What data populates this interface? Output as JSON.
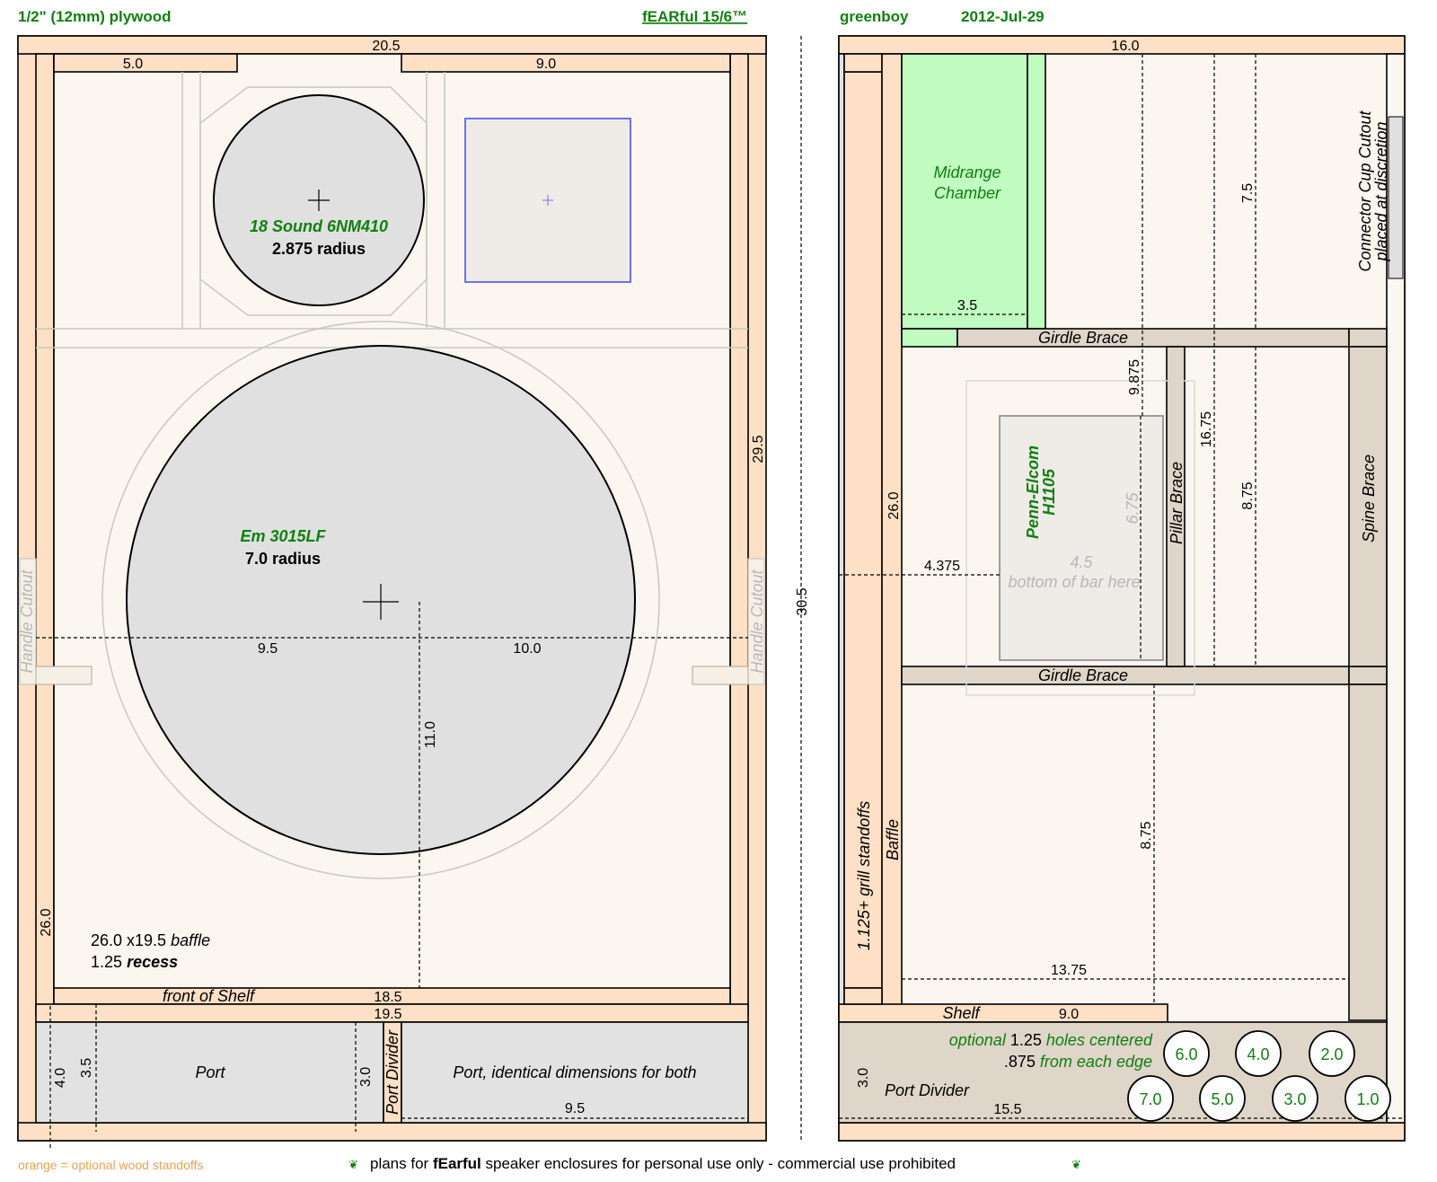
{
  "header": {
    "material": "1/2\" (12mm) plywood",
    "title": "fEARful 15/6™",
    "author": "greenboy",
    "date": "2012-Jul-29"
  },
  "front": {
    "dim_top": "20.5",
    "dim_5": "5.0",
    "dim_9": "9.0",
    "dim_29_5": "29.5",
    "dim_26": "26.0",
    "dim_9_5": "9.5",
    "dim_10": "10.0",
    "dim_11": "11.0",
    "dim_18_5": "18.5",
    "dim_19_5": "19.5",
    "dim_4": "4.0",
    "dim_3_5": "3.5",
    "dim_3": "3.0",
    "dim_port_w": "9.5",
    "mid_driver": "18 Sound 6NM410",
    "mid_radius": "2.875 radius",
    "woofer": "Em 3015LF",
    "woofer_radius": "7.0 radius",
    "handle_left": "Handle Cutout",
    "handle_right": "Handle Cutout",
    "baffle_note": "26.0 x19.5",
    "baffle_word": "baffle",
    "recess_val": "1.25",
    "recess_word": "recess",
    "shelf_front": "front of Shelf",
    "port_left": "Port",
    "port_divider": "Port Divider",
    "port_right": "Port, identical dimensions for both"
  },
  "overall_height": "30.5",
  "side": {
    "dim_top": "16.0",
    "connector": "Connector Cup Cutout",
    "connector_note": "placed at discretion",
    "dim_7_5": "7.5",
    "midrange_chamber_1": "Midrange",
    "midrange_chamber_2": "Chamber",
    "dim_3_5": "3.5",
    "girdle_top": "Girdle Brace",
    "dim_9_875": "9.875",
    "dim_16_75": "16.75",
    "dim_8_75_top": "8.75",
    "spine": "Spine Brace",
    "pillar": "Pillar Brace",
    "dim_26": "26.0",
    "horn_1": "Penn-Elcom",
    "horn_2": "H1105",
    "dim_6_75": "6.75",
    "dim_4_5": "4.5",
    "bar_note": "bottom of bar here",
    "dim_4_375": "4.375",
    "girdle_bottom": "Girdle Brace",
    "dim_8_75_bottom": "8.75",
    "baffle": "Baffle",
    "grill": "1.125+ grill standoffs",
    "dim_13_75": "13.75",
    "shelf": "Shelf",
    "dim_9": "9.0",
    "holes_note_1a": "optional",
    "holes_note_1b": "1.25",
    "holes_note_1c": "holes centered",
    "holes_note_2a": ".875",
    "holes_note_2b": "from each edge",
    "dim_3": "3.0",
    "port_divider": "Port Divider",
    "dim_15_5": "15.5",
    "holes_top": [
      "6.0",
      "4.0",
      "2.0"
    ],
    "holes_bottom": [
      "7.0",
      "5.0",
      "3.0",
      "1.0"
    ]
  },
  "footer": {
    "legend": "orange = optional wood standoffs",
    "notice_a": "plans for",
    "notice_b": "fEarful",
    "notice_c": "speaker enclosures for personal use only - commercial use prohibited"
  },
  "colors": {
    "wood": "#fde0c5",
    "panel": "#fbf6f0",
    "port": "#e2e2e2",
    "brace": "#dfd5c9",
    "chamber": "#c0fbbf",
    "label_green": "#108010",
    "legend_orange": "#f0a050",
    "tweeter_outline": "#7070ee"
  }
}
